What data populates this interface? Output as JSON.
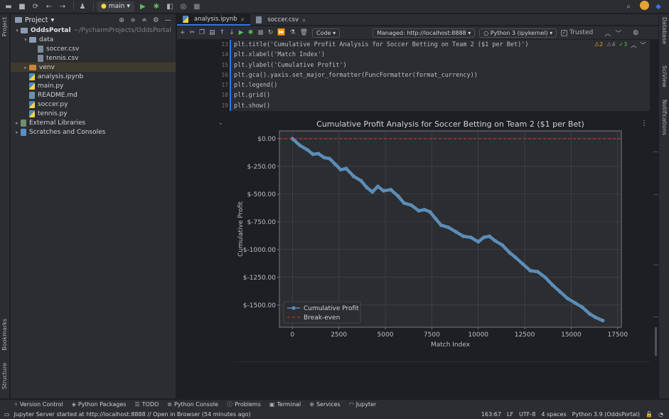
{
  "toolbar": {
    "branch": "main"
  },
  "project_panel": {
    "title": "Project",
    "tree": [
      {
        "name": "OddsPortal",
        "path": "~/PycharmProjects/OddsPortal",
        "type": "folder",
        "depth": 0
      },
      {
        "name": "data",
        "type": "folder",
        "depth": 1
      },
      {
        "name": "soccer.csv",
        "type": "file",
        "depth": 2
      },
      {
        "name": "tennis.csv",
        "type": "file",
        "depth": 2
      },
      {
        "name": "venv",
        "type": "folder-orange",
        "depth": 1
      },
      {
        "name": "analysis.ipynb",
        "type": "py",
        "depth": 1
      },
      {
        "name": "main.py",
        "type": "py",
        "depth": 1
      },
      {
        "name": "README.md",
        "type": "md",
        "depth": 1
      },
      {
        "name": "soccer.py",
        "type": "py",
        "depth": 1
      },
      {
        "name": "tennis.py",
        "type": "py",
        "depth": 1
      },
      {
        "name": "External Libraries",
        "type": "lib",
        "depth": 0
      },
      {
        "name": "Scratches and Consoles",
        "type": "scratch",
        "depth": 0
      }
    ]
  },
  "tabs": [
    {
      "label": "analysis.ipynb"
    },
    {
      "label": "soccer.csv"
    }
  ],
  "notebook_toolbar": {
    "cell_type": "Code",
    "server": "Managed: http://localhost:8888",
    "kernel": "Python 3 (ipykernel)",
    "trusted": "Trusted"
  },
  "inspections": {
    "warnings": "2",
    "weak": "4",
    "ok": "3"
  },
  "code": {
    "line_numbers": [
      "13",
      "14",
      "15",
      "16",
      "17",
      "18",
      "19"
    ],
    "lines": [
      "plt.title('Cumulative Profit Analysis for Soccer Betting on Team 2 ($1 per Bet)')",
      "plt.xlabel('Match Index')",
      "plt.ylabel('Cumulative Profit')",
      "plt.gca().yaxis.set_major_formatter(FuncFormatter(format_currency))",
      "plt.legend()",
      "plt.grid()",
      "plt.show()"
    ]
  },
  "chart_data": {
    "type": "line",
    "title": "Cumulative Profit Analysis for Soccer Betting on Team 2 ($1 per Bet)",
    "xlabel": "Match Index",
    "ylabel": "Cumulative Profit",
    "xlim": [
      -700,
      17700
    ],
    "ylim": [
      -1700,
      70
    ],
    "xticks": [
      0,
      2500,
      5000,
      7500,
      10000,
      12500,
      15000,
      17500
    ],
    "yticks": [
      0,
      -250,
      -500,
      -750,
      -1000,
      -1250,
      -1500
    ],
    "ytick_labels": [
      "$0.00",
      "$-250.00",
      "$-500.00",
      "$-750.00",
      "$-1000.00",
      "$-1250.00",
      "$-1500.00"
    ],
    "grid": true,
    "legend": "bottom-left",
    "series": [
      {
        "name": "Cumulative Profit",
        "color": "#5b8db8",
        "x": [
          0,
          400,
          800,
          1100,
          1400,
          1700,
          2000,
          2300,
          2600,
          2900,
          3300,
          3700,
          4000,
          4300,
          4600,
          4900,
          5300,
          5700,
          6000,
          6400,
          6800,
          7100,
          7400,
          7700,
          8000,
          8400,
          8800,
          9200,
          9600,
          10000,
          10300,
          10600,
          10900,
          11300,
          11700,
          12000,
          12400,
          12800,
          13200,
          13600,
          14000,
          14400,
          14800,
          15200,
          15600,
          16000,
          16300,
          16700
        ],
        "y": [
          0,
          -60,
          -100,
          -140,
          -135,
          -170,
          -180,
          -230,
          -280,
          -270,
          -340,
          -380,
          -440,
          -480,
          -430,
          -470,
          -460,
          -520,
          -580,
          -600,
          -650,
          -640,
          -660,
          -720,
          -780,
          -800,
          -840,
          -880,
          -890,
          -930,
          -890,
          -880,
          -920,
          -960,
          -1030,
          -1070,
          -1130,
          -1190,
          -1200,
          -1250,
          -1320,
          -1380,
          -1440,
          -1480,
          -1520,
          -1580,
          -1610,
          -1640
        ]
      },
      {
        "name": "Break-even",
        "color": "#d33b3b",
        "style": "dashed",
        "x": [
          -700,
          17700
        ],
        "y": [
          0,
          0
        ]
      }
    ]
  },
  "bottom_tools": [
    "Version Control",
    "Python Packages",
    "TODO",
    "Python Console",
    "Problems",
    "Terminal",
    "Services",
    "Jupyter"
  ],
  "status": {
    "message": "Jupyter Server started at http://localhost:8888 // Open in Browser (54 minutes ago)",
    "position": "163:67",
    "line_sep": "LF",
    "encoding": "UTF-8",
    "indent": "4 spaces",
    "interpreter": "Python 3.9 (OddsPortal)"
  },
  "side_labels": {
    "project": "Project",
    "bookmarks": "Bookmarks",
    "structure": "Structure",
    "database": "Database",
    "sciview": "SciView",
    "notifications": "Notifications"
  }
}
